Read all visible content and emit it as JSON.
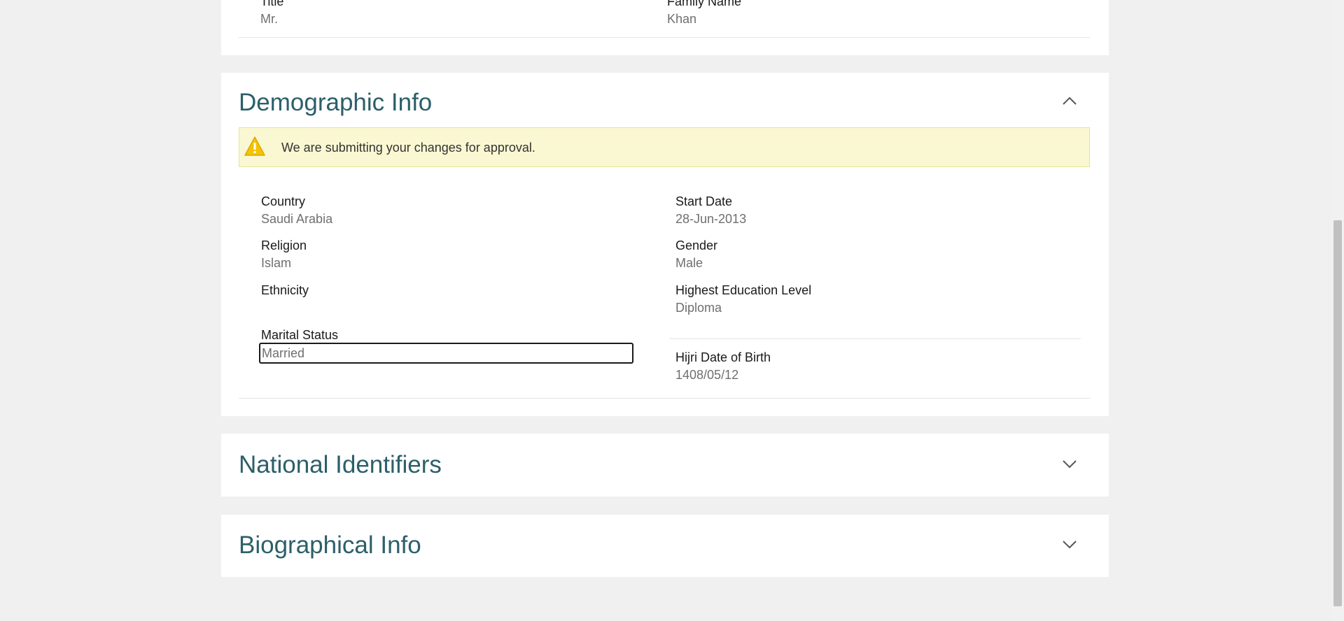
{
  "top_section": {
    "left": {
      "label": "Title",
      "value": "Mr."
    },
    "right": {
      "label": "Family Name",
      "value": "Khan"
    }
  },
  "demographic": {
    "title": "Demographic Info",
    "collapse_icon": "chevron-up-icon",
    "warning": {
      "icon": "warning-icon",
      "text": "We are submitting your changes for approval."
    },
    "fields": {
      "country": {
        "label": "Country",
        "value": "Saudi Arabia"
      },
      "start_date": {
        "label": "Start Date",
        "value": "28-Jun-2013"
      },
      "religion": {
        "label": "Religion",
        "value": "Islam"
      },
      "gender": {
        "label": "Gender",
        "value": "Male"
      },
      "ethnicity": {
        "label": "Ethnicity",
        "value": ""
      },
      "education": {
        "label": "Highest Education Level",
        "value": "Diploma"
      },
      "marital": {
        "label": "Marital Status",
        "value": "Married"
      },
      "hijri": {
        "label": "Hijri Date of Birth",
        "value": "1408/05/12"
      }
    }
  },
  "national": {
    "title": "National Identifiers",
    "expand_icon": "chevron-down-icon"
  },
  "biographical": {
    "title": "Biographical Info",
    "expand_icon": "chevron-down-icon"
  },
  "colors": {
    "section_title": "#2c5f6a",
    "warning_bg": "#faf8d2",
    "warning_icon": "#f4c400"
  }
}
